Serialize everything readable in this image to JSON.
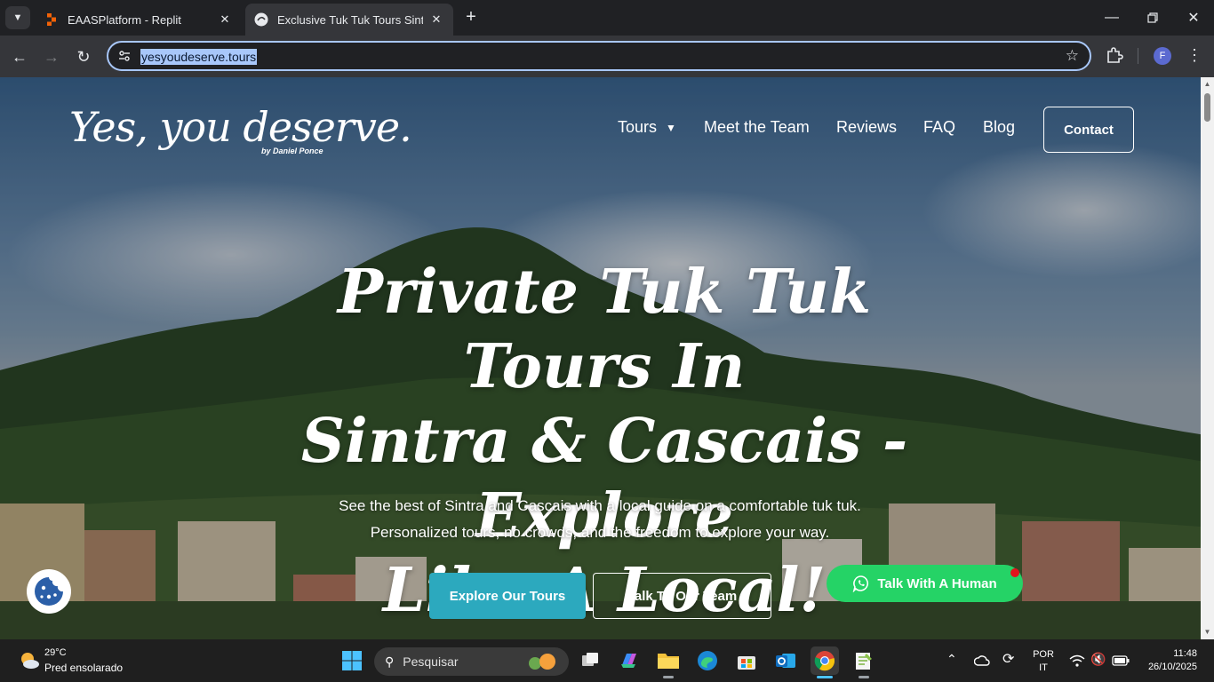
{
  "browser": {
    "tabs": [
      {
        "title": "EAASPlatform - Replit",
        "active": false,
        "favicon": "replit-icon"
      },
      {
        "title": "Exclusive Tuk Tuk Tours Sintra &",
        "active": true,
        "favicon": "site-favicon"
      }
    ],
    "url": "yesyoudeserve.tours",
    "profile_initial": "F",
    "icons": {
      "tab_search": "chevron-down-icon",
      "back": "back-arrow-icon",
      "forward": "forward-arrow-icon",
      "reload": "reload-icon",
      "site_info": "tune-icon",
      "bookmark": "star-icon",
      "extensions": "puzzle-icon",
      "menu": "kebab-icon"
    }
  },
  "site": {
    "logo_text": "Yes, you deserve.",
    "logo_byline": "by Daniel Ponce",
    "nav": {
      "tours": "Tours",
      "team": "Meet the Team",
      "reviews": "Reviews",
      "faq": "FAQ",
      "blog": "Blog",
      "contact": "Contact"
    },
    "hero": {
      "title_line1": "Private Tuk Tuk Tours In",
      "title_line2": "Sintra & Cascais - Explore",
      "title_line3": "Like A Local!",
      "subtitle_line1": "See the best of Sintra and Cascais with a local guide on a comfortable tuk tuk.",
      "subtitle_line2": "Personalized tours, no crowds, and the freedom to explore your way."
    },
    "buttons": {
      "explore": "Explore Our Tours",
      "team": "Talk To Our Team",
      "whatsapp": "Talk With A Human"
    },
    "colors": {
      "explore_bg": "#2ca9be",
      "whatsapp_bg": "#25d366",
      "notification_dot": "#e3141c"
    }
  },
  "taskbar": {
    "weather_temp": "29°C",
    "weather_desc": "Pred ensolarado",
    "search_placeholder": "Pesquisar",
    "lang_line1": "POR",
    "lang_line2": "IT",
    "time": "11:48",
    "date": "26/10/2025",
    "apps": [
      "windows-start-icon",
      "task-view-icon",
      "m365-copilot-icon",
      "file-explorer-icon",
      "edge-icon",
      "microsoft-store-icon",
      "outlook-icon",
      "chrome-icon",
      "notepad-plus-icon"
    ]
  }
}
